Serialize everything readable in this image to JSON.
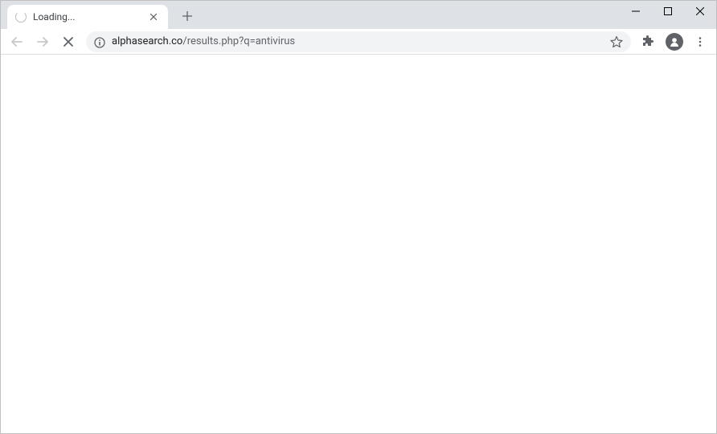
{
  "tab": {
    "title": "Loading..."
  },
  "url": {
    "host": "alphasearch.co",
    "path": "/results.php?q=antivirus"
  }
}
